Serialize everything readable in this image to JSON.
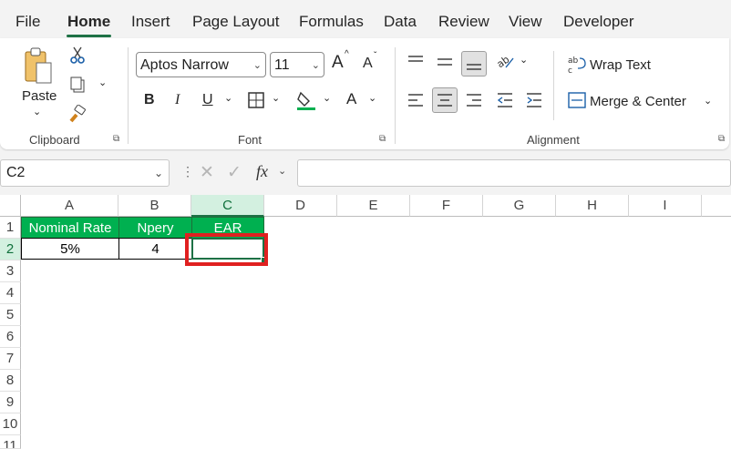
{
  "menu": {
    "file": "File",
    "home": "Home",
    "insert": "Insert",
    "page_layout": "Page Layout",
    "formulas": "Formulas",
    "data": "Data",
    "review": "Review",
    "view": "View",
    "developer": "Developer"
  },
  "clipboard": {
    "paste": "Paste",
    "label": "Clipboard"
  },
  "font": {
    "family": "Aptos Narrow",
    "size": "11",
    "label": "Font",
    "bold": "B",
    "italic": "I",
    "underline": "U",
    "grow": "A",
    "shrink": "A",
    "color_letter": "A"
  },
  "alignment": {
    "wrap_text": "Wrap Text",
    "merge_center": "Merge & Center",
    "label": "Alignment"
  },
  "formula_bar": {
    "name_box": "C2",
    "fx": "fx",
    "content": ""
  },
  "columns": [
    "A",
    "B",
    "C",
    "D",
    "E",
    "F",
    "G",
    "H",
    "I"
  ],
  "rows": [
    "1",
    "2",
    "3",
    "4",
    "5",
    "6",
    "7",
    "8",
    "9",
    "10",
    "11"
  ],
  "cells": {
    "A1": "Nominal Rate",
    "B1": "Npery",
    "C1": "EAR",
    "A2": "5%",
    "B2": "4",
    "C2": ""
  },
  "colors": {
    "accent": "#1e7145",
    "header_fill": "#00b050",
    "highlight_box": "#e02020"
  }
}
